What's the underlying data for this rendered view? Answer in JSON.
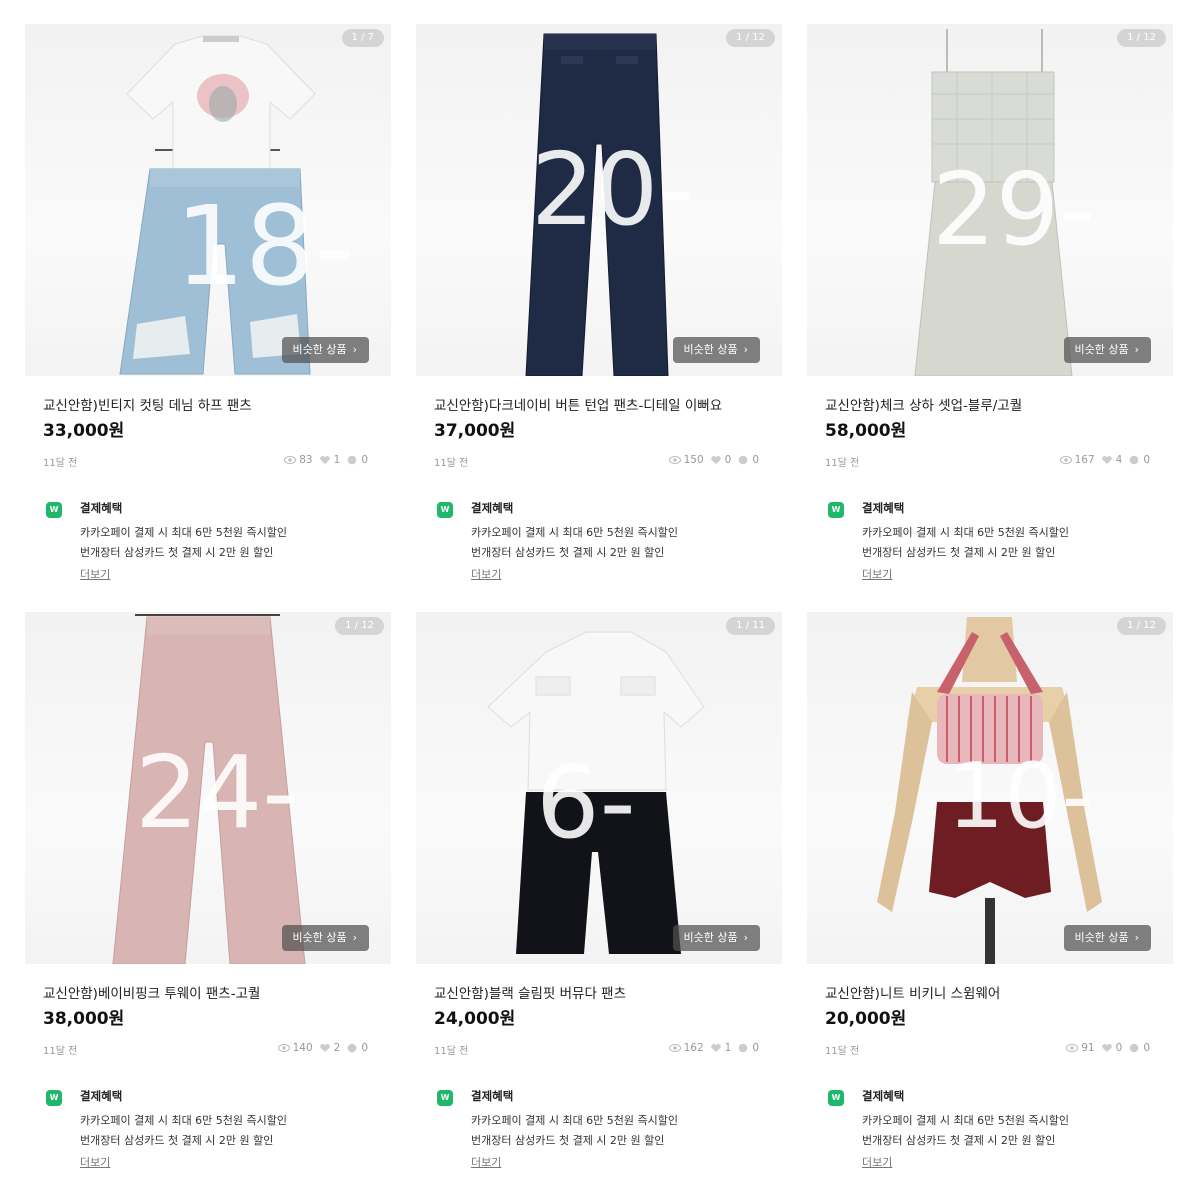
{
  "common": {
    "similar_label": "비슷한 상품",
    "benefit_title": "결제혜택",
    "benefit_line1": "카카오페이 결제 시 최대 6만 5천원 즉시할인",
    "benefit_line2": "번개장터 삼성카드 첫 결제 시 2만 원  할인",
    "more_label": "더보기",
    "badge_text": "W"
  },
  "products": [
    {
      "counter": "1 / 7",
      "title": "교신안함)빈티지 컷팅 데님 하프 팬츠",
      "price": "33,000원",
      "time": "11달 전",
      "views": "83",
      "likes": "1",
      "chats": "0",
      "overlay": "18-"
    },
    {
      "counter": "1 / 12",
      "title": "교신안함)다크네이비 버튼 턴업 팬츠-디테일 이뻐요",
      "price": "37,000원",
      "time": "11달 전",
      "views": "150",
      "likes": "0",
      "chats": "0",
      "overlay": "20-"
    },
    {
      "counter": "1 / 12",
      "title": "교신안함)체크 상하 셋업-블루/고퀄",
      "price": "58,000원",
      "time": "11달 전",
      "views": "167",
      "likes": "4",
      "chats": "0",
      "overlay": "29-"
    },
    {
      "counter": "1 / 12",
      "title": "교신안함)베이비핑크 투웨이 팬츠-고퀄",
      "price": "38,000원",
      "time": "11달 전",
      "views": "140",
      "likes": "2",
      "chats": "0",
      "overlay": "24-"
    },
    {
      "counter": "1 / 11",
      "title": "교신안함)블랙 슬림핏 버뮤다 팬츠",
      "price": "24,000원",
      "time": "11달 전",
      "views": "162",
      "likes": "1",
      "chats": "0",
      "overlay": "6-"
    },
    {
      "counter": "1 / 12",
      "title": "교신안함)니트 비키니 스윔웨어",
      "price": "20,000원",
      "time": "11달 전",
      "views": "91",
      "likes": "0",
      "chats": "0",
      "overlay": "10-"
    }
  ]
}
